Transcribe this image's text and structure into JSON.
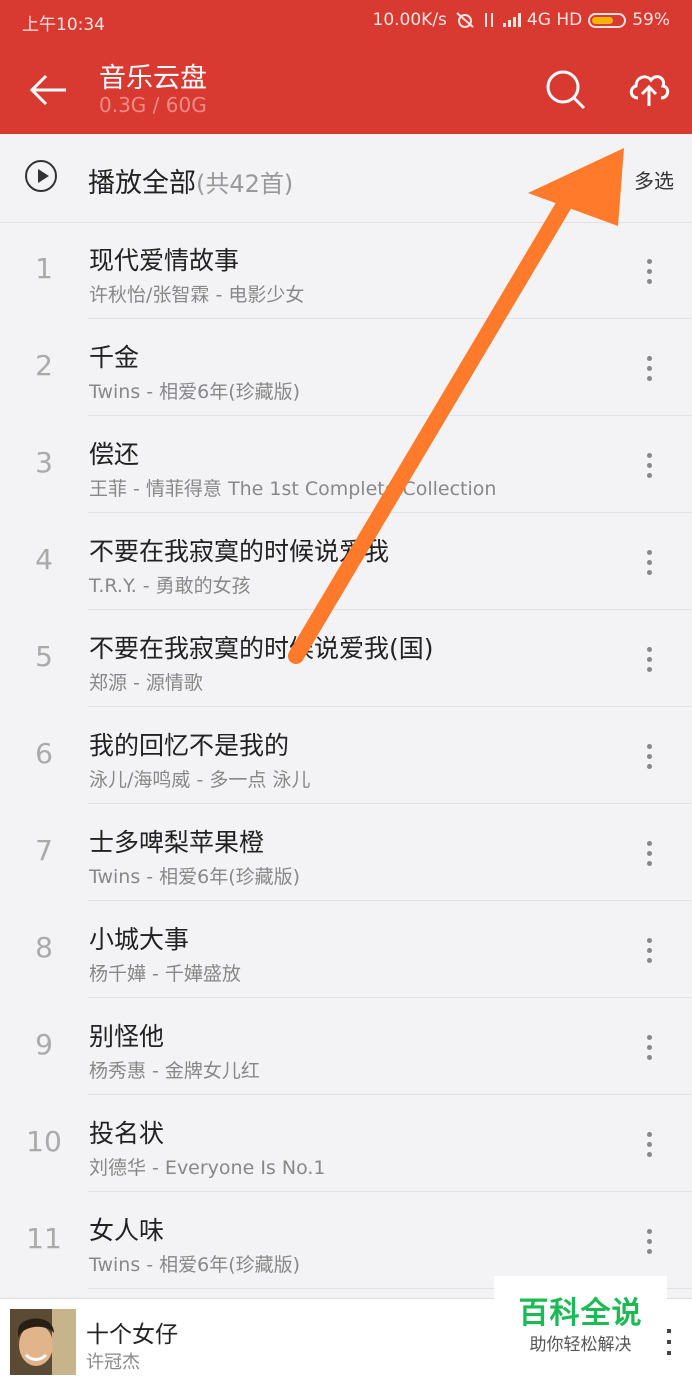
{
  "status_bar": {
    "time": "上午10:34",
    "net_speed": "10.00K/s",
    "network": "4G HD",
    "battery": "59%"
  },
  "header": {
    "title": "音乐云盘",
    "subtitle": "0.3G / 60G",
    "icons": [
      "back-arrow-icon",
      "search-icon",
      "cloud-upload-icon"
    ]
  },
  "play_all": {
    "label": "播放全部",
    "count": "(共42首)",
    "multi_select": "多选"
  },
  "songs": [
    {
      "index": "1",
      "title": "现代爱情故事",
      "meta": "许秋怡/张智霖 - 电影少女"
    },
    {
      "index": "2",
      "title": "千金",
      "meta": "Twins - 相爱6年(珍藏版)"
    },
    {
      "index": "3",
      "title": "偿还",
      "meta": "王菲 - 情菲得意 The 1st Complete Collection"
    },
    {
      "index": "4",
      "title": "不要在我寂寞的时候说爱我",
      "meta": "T.R.Y. - 勇敢的女孩"
    },
    {
      "index": "5",
      "title": "不要在我寂寞的时候说爱我(国)",
      "meta": "郑源 - 源情歌"
    },
    {
      "index": "6",
      "title": "我的回忆不是我的",
      "meta": "泳儿/海鸣威 - 多一点 泳儿"
    },
    {
      "index": "7",
      "title": "士多啤梨苹果橙",
      "meta": "Twins - 相爱6年(珍藏版)"
    },
    {
      "index": "8",
      "title": "小城大事",
      "meta": "杨千嬅 - 千嬅盛放"
    },
    {
      "index": "9",
      "title": "别怪他",
      "meta": "杨秀惠 - 金牌女儿红"
    },
    {
      "index": "10",
      "title": "投名状",
      "meta": "刘德华 - Everyone Is No.1"
    },
    {
      "index": "11",
      "title": "女人味",
      "meta": "Twins - 相爱6年(珍藏版)"
    }
  ],
  "now_playing": {
    "title": "十个女仔",
    "artist": "许冠杰"
  },
  "watermark": {
    "big": "百科全说",
    "small": "助你轻松解决"
  },
  "colors": {
    "header": "#d83a31",
    "annotation_arrow": "#ff7a2a",
    "watermark_green": "#1db954"
  }
}
